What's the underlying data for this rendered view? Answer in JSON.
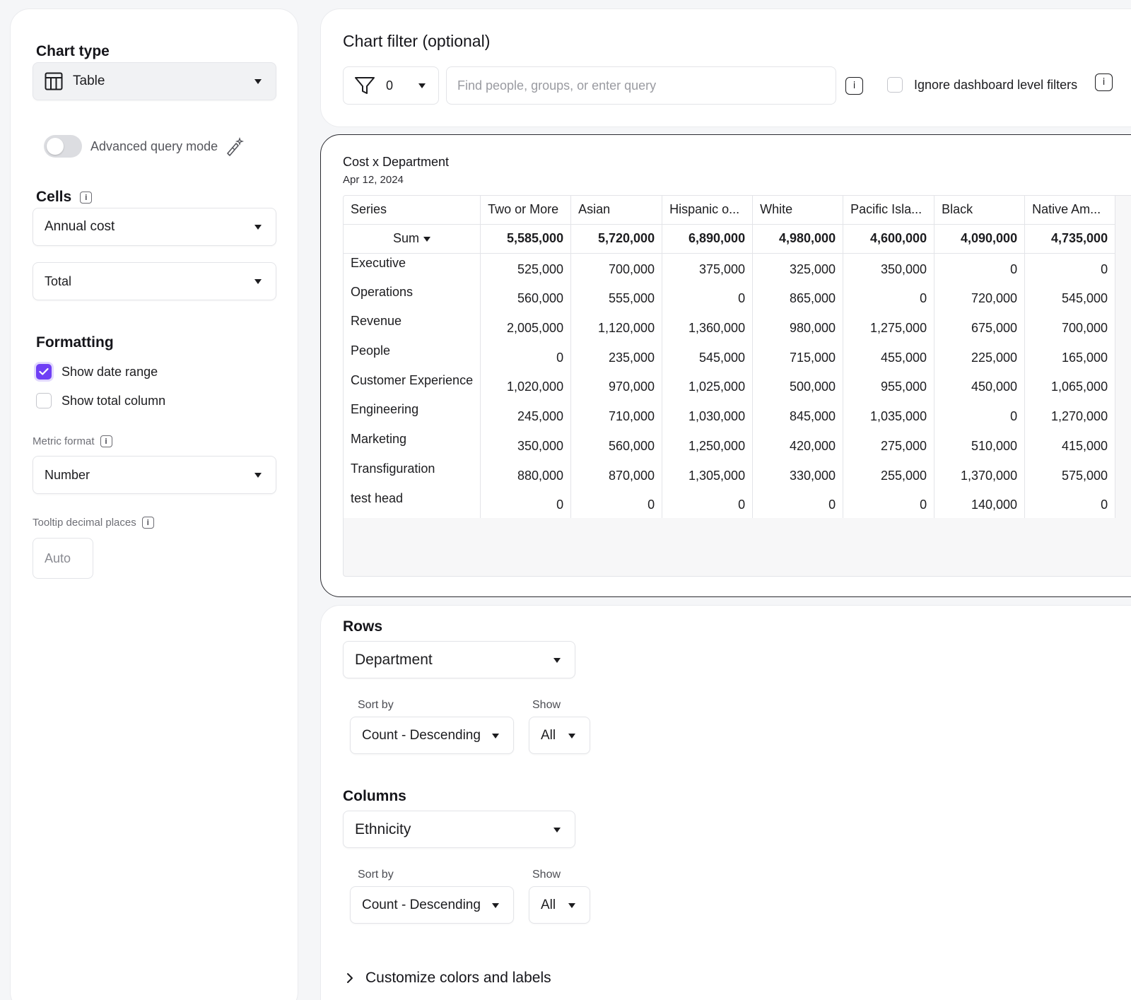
{
  "left_panel": {
    "chart_type_title": "Chart type",
    "chart_type_value": "Table",
    "advanced_query_label": "Advanced query mode",
    "cells_title": "Cells",
    "cells_metric": "Annual cost",
    "cells_aggregation": "Total",
    "formatting_title": "Formatting",
    "show_date_range_label": "Show date range",
    "show_date_range_checked": true,
    "show_total_column_label": "Show total column",
    "show_total_column_checked": false,
    "metric_format_label": "Metric format",
    "metric_format_value": "Number",
    "tooltip_decimal_label": "Tooltip decimal places",
    "tooltip_decimal_placeholder": "Auto"
  },
  "filter": {
    "title": "Chart filter (optional)",
    "count": "0",
    "search_placeholder": "Find people, groups, or enter query",
    "ignore_label": "Ignore dashboard level filters"
  },
  "chart": {
    "title": "Cost x Department",
    "date": "Apr 12, 2024"
  },
  "chart_data": {
    "type": "table",
    "series_header": "Series",
    "columns": [
      "Two or More",
      "Asian",
      "Hispanic o...",
      "White",
      "Pacific Isla...",
      "Black",
      "Native Am..."
    ],
    "sum_label": "Sum",
    "sums": [
      "5,585,000",
      "5,720,000",
      "6,890,000",
      "4,980,000",
      "4,600,000",
      "4,090,000",
      "4,735,000"
    ],
    "rows": [
      {
        "label": "Executive",
        "values": [
          "525,000",
          "700,000",
          "375,000",
          "325,000",
          "350,000",
          "0",
          "0"
        ]
      },
      {
        "label": "Operations",
        "values": [
          "560,000",
          "555,000",
          "0",
          "865,000",
          "0",
          "720,000",
          "545,000"
        ]
      },
      {
        "label": "Revenue",
        "values": [
          "2,005,000",
          "1,120,000",
          "1,360,000",
          "980,000",
          "1,275,000",
          "675,000",
          "700,000"
        ]
      },
      {
        "label": "People",
        "values": [
          "0",
          "235,000",
          "545,000",
          "715,000",
          "455,000",
          "225,000",
          "165,000"
        ]
      },
      {
        "label": "Customer Experience",
        "values": [
          "1,020,000",
          "970,000",
          "1,025,000",
          "500,000",
          "955,000",
          "450,000",
          "1,065,000"
        ]
      },
      {
        "label": "Engineering",
        "values": [
          "245,000",
          "710,000",
          "1,030,000",
          "845,000",
          "1,035,000",
          "0",
          "1,270,000"
        ]
      },
      {
        "label": "Marketing",
        "values": [
          "350,000",
          "560,000",
          "1,250,000",
          "420,000",
          "275,000",
          "510,000",
          "415,000"
        ]
      },
      {
        "label": "Transfiguration",
        "values": [
          "880,000",
          "870,000",
          "1,305,000",
          "330,000",
          "255,000",
          "1,370,000",
          "575,000"
        ]
      },
      {
        "label": "test head",
        "values": [
          "0",
          "0",
          "0",
          "0",
          "0",
          "140,000",
          "0"
        ]
      }
    ]
  },
  "config": {
    "rows_title": "Rows",
    "rows_value": "Department",
    "rows_sort_label": "Sort by",
    "rows_sort_value": "Count - Descending",
    "rows_show_label": "Show",
    "rows_show_value": "All",
    "columns_title": "Columns",
    "columns_value": "Ethnicity",
    "columns_sort_label": "Sort by",
    "columns_sort_value": "Count - Descending",
    "columns_show_label": "Show",
    "columns_show_value": "All",
    "customize_label": "Customize colors and labels"
  },
  "colors": {
    "accent": "#6f3ff5",
    "page_bg": "#f5f6f8",
    "border": "#e3e4e8"
  }
}
